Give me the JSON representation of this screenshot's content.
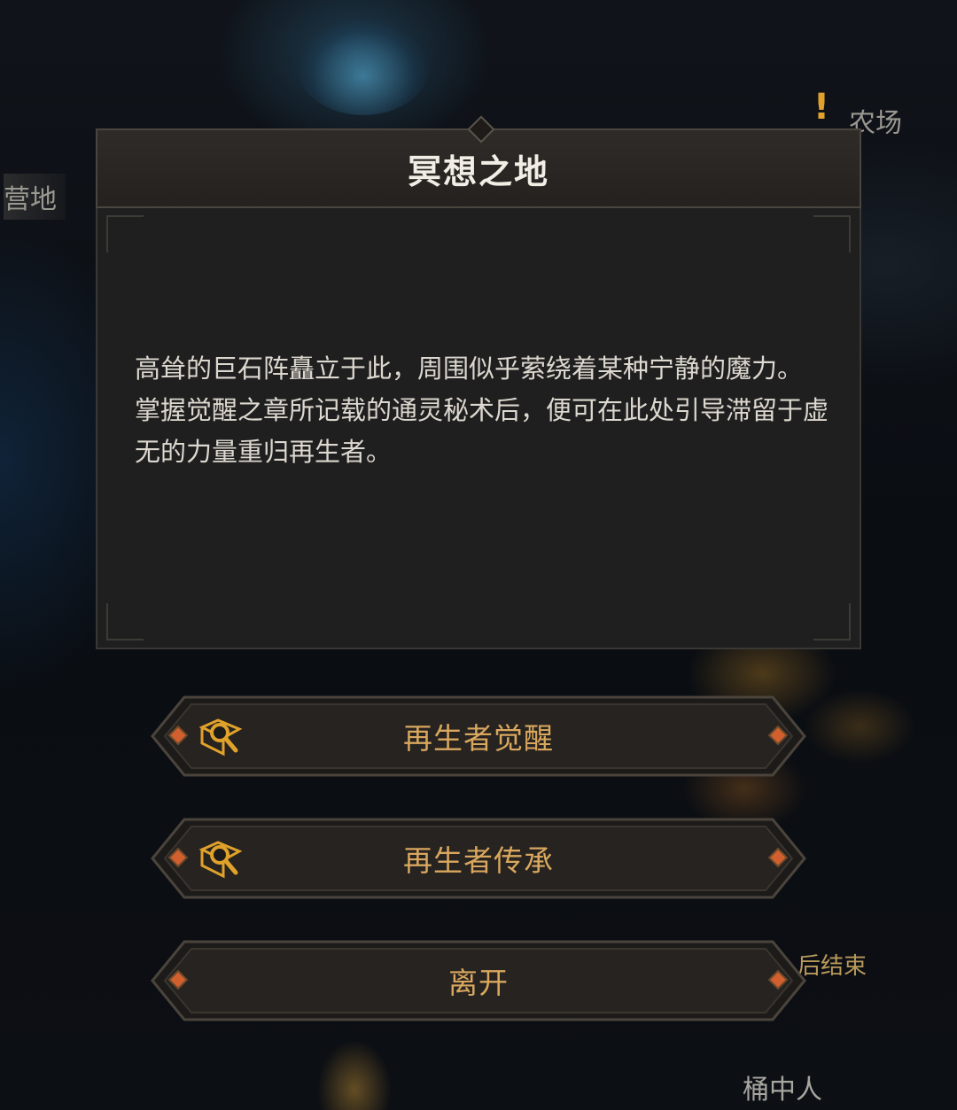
{
  "map": {
    "labels": {
      "camp": "营地",
      "farm": "农场",
      "bucket": "桶中人",
      "end_partial": "后结束"
    },
    "quest_marker_icon": "exclamation-icon"
  },
  "dialog": {
    "title": "冥想之地",
    "paragraph1": "高耸的巨石阵矗立于此，周围似乎萦绕着某种宁静的魔力。",
    "paragraph2": "掌握觉醒之章所记载的通灵秘术后，便可在此处引导滞留于虚无的力量重归再生者。"
  },
  "options": [
    {
      "label": "再生者觉醒",
      "icon": "magnifier-book-icon"
    },
    {
      "label": "再生者传承",
      "icon": "magnifier-book-icon"
    },
    {
      "label": "离开"
    }
  ],
  "colors": {
    "option_text": "#d9a75e",
    "accent_gem": "#d2602f",
    "title_text": "#f2eee6",
    "icon_gold": "#e0a22a"
  }
}
